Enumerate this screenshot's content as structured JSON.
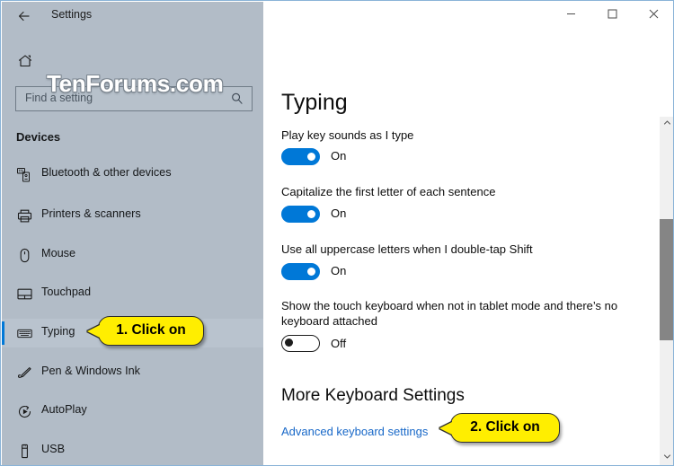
{
  "window": {
    "title": "Settings",
    "back_icon": "back-arrow-icon",
    "controls": {
      "minimize": "–",
      "maximize": "☐",
      "close": "✕"
    },
    "accent_color": "#0078d7",
    "sidebar_color": "#b2bcc7",
    "link_color": "#1868c8",
    "callout_color": "#ffee00"
  },
  "watermark": {
    "text": "TenForums.com"
  },
  "sidebar": {
    "home_icon": "home-icon",
    "search": {
      "placeholder": "Find a setting",
      "value": "",
      "icon": "search-icon"
    },
    "group_heading": "Devices",
    "items": [
      {
        "label": "Bluetooth & other devices",
        "icon": "bluetooth-devices-icon",
        "selected": false
      },
      {
        "label": "Printers & scanners",
        "icon": "printer-icon",
        "selected": false
      },
      {
        "label": "Mouse",
        "icon": "mouse-icon",
        "selected": false
      },
      {
        "label": "Touchpad",
        "icon": "touchpad-icon",
        "selected": false
      },
      {
        "label": "Typing",
        "icon": "keyboard-icon",
        "selected": true
      },
      {
        "label": "Pen & Windows Ink",
        "icon": "pen-icon",
        "selected": false
      },
      {
        "label": "AutoPlay",
        "icon": "autoplay-icon",
        "selected": false
      },
      {
        "label": "USB",
        "icon": "usb-icon",
        "selected": false
      }
    ]
  },
  "main": {
    "page_title": "Typing",
    "settings": [
      {
        "label": "Play key sounds as I type",
        "state": "On",
        "on": true
      },
      {
        "label": "Capitalize the first letter of each sentence",
        "state": "On",
        "on": true
      },
      {
        "label": "Use all uppercase letters when I double-tap Shift",
        "state": "On",
        "on": true
      },
      {
        "label": "Show the touch keyboard when not in tablet mode and there’s no keyboard attached",
        "state": "Off",
        "on": false
      }
    ],
    "more_heading": "More Keyboard Settings",
    "advanced_link": "Advanced keyboard settings"
  },
  "callouts": [
    {
      "text": "1. Click on"
    },
    {
      "text": "2. Click on"
    }
  ],
  "scrollbar": {
    "up_arrow": "∧",
    "down_arrow": "∨"
  }
}
